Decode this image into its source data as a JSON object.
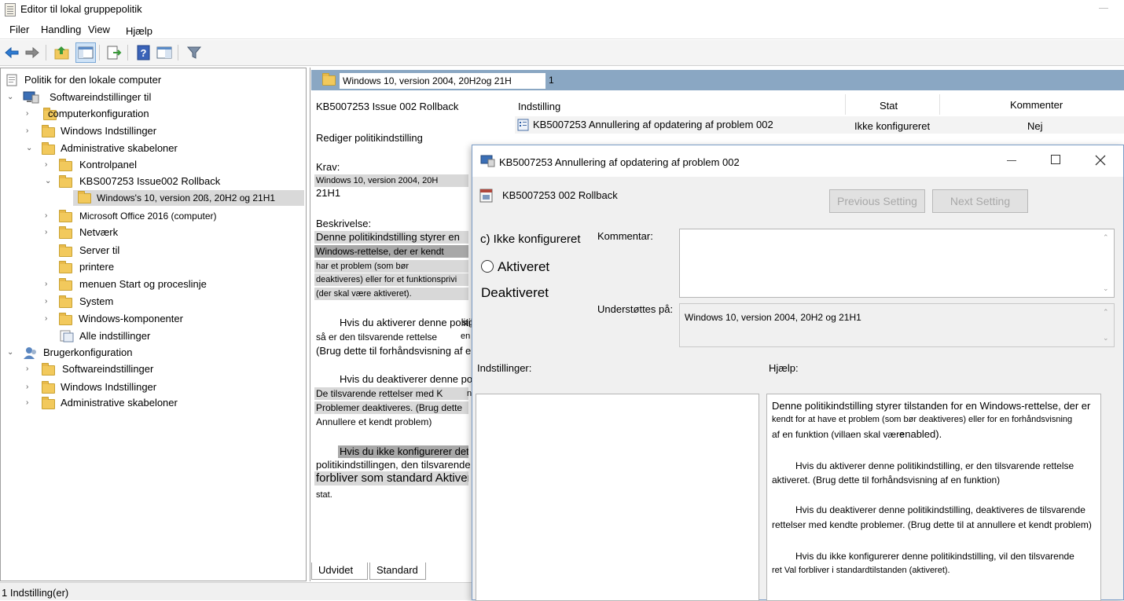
{
  "window": {
    "title": "Editor til lokal gruppepolitik"
  },
  "menu": {
    "items": [
      "Filer",
      "Handling",
      "View",
      "Hjælp"
    ]
  },
  "toolbar": {
    "icons": [
      "back-icon",
      "forward-icon",
      "up-folder-icon",
      "show-hide-tree-icon",
      "export-list-icon",
      "help-icon",
      "properties-pane-icon",
      "filter-icon"
    ]
  },
  "tree": {
    "root": "Politik for den lokale computer",
    "computer": "Softwareindstillinger til",
    "computer_cont": "computerkonfiguration",
    "windows_settings": "Windows Indstillinger",
    "admin_templates": "Administrative skabeloner",
    "control_panel": "Kontrolpanel",
    "kb_rollback": "KBS007253 Issue002 Rollback",
    "windows_version": "Windows's 10, version 20ß, 20H2 og 21H1",
    "office": "Microsoft Office 2016 (computer)",
    "network": "Netværk",
    "server": "Server til",
    "printers": "printere",
    "start_menu": "menuen Start og proceslinje",
    "system": "System",
    "windows_components": "Windows-komponenter",
    "all_settings": "Alle indstillinger",
    "user_config": "Brugerkonfiguration",
    "user_software": "Softwareindstillinger",
    "user_windows": "Windows Indstillinger",
    "user_admin": "Administrative skabeloner"
  },
  "right_pane": {
    "header": "Windows 10, version 2004, 20H2og 21H",
    "header_suffix": "1",
    "policy_title": "KB5007253 Issue 002 Rollback",
    "edit_link": "Rediger politikindstilling",
    "requirements_label": "Krav:",
    "requirements_line1": "Windows 10, version 2004, 20H",
    "requirements_line2": "21H1",
    "description_label": "Beskrivelse:",
    "desc_lines": [
      "Denne politikindstilling styrer en",
      "Windows-rettelse, der er kendt",
      "har et problem (som bør",
      "deaktiveres) eller for et funktionsprivi",
      "(der skal være aktiveret).",
      "Hvis du aktiverer denne politik,",
      "så er den tilsvarende rettelse",
      "(Brug dette til forhåndsvisning af en funktion)",
      "Hvis du deaktiverer denne politik",
      "De tilsvarende rettelser med K",
      "Problemer deaktiveres. (Brug dette",
      "Annullere et kendt problem)",
      "Hvis du ikke konfigurerer dette",
      "politikindstillingen, den tilsvarende",
      "forbliver som standard Aktiver",
      "stat."
    ],
    "overlap_fragments": [
      "sig",
      "en",
      "n"
    ],
    "columns": {
      "setting": "Indstilling",
      "state": "Stat",
      "comment": "Kommenter"
    },
    "rows": [
      {
        "setting": "KB5007253 Annullering af opdatering af problem 002",
        "state": "Ikke konfigureret",
        "comment": "Nej"
      }
    ],
    "tabs": [
      "Udvidet",
      "Standard"
    ]
  },
  "status_bar": {
    "text": "1 Indstilling(er)"
  },
  "dialog": {
    "title": "KB5007253  Annullering af opdatering af problem 002",
    "subtitle": "KB5007253 002 Rollback",
    "prev_button": "Previous Setting",
    "next_button": "Next Setting",
    "option_not_configured": "c) Ikke konfigureret",
    "option_enabled": "Aktiveret",
    "option_disabled": "Deaktiveret",
    "comment_label": "Kommentar:",
    "supported_label": "Understøttes på:",
    "supported_value": "Windows 10, version 2004, 20H2 og 21H1",
    "options_label": "Indstillinger:",
    "help_label": "Hjælp:",
    "help_lines": [
      "Denne politikindstilling styrer tilstanden for en Windows-rettelse, der er",
      "kendt for at have et problem (som bør deaktiveres) eller for en forhåndsvisning",
      "af en funktion (villaen skal være",
      "enabled).",
      "Hvis du aktiverer denne politikindstilling, er den tilsvarende rettelse",
      "aktiveret. (Brug dette til forhåndsvisning af en funktion)",
      "Hvis du deaktiverer denne politikindstilling, deaktiveres de tilsvarende",
      "rettelser med kendte problemer. (Brug dette til at annullere et kendt problem)",
      "Hvis du ikke konfigurerer denne politikindstilling, vil den tilsvarende",
      "ret Val forbliver i standardtilstanden (aktiveret)."
    ]
  },
  "colors": {
    "header_blue": "#8aa7c3",
    "selection_gray": "#d9d9d9",
    "dialog_border": "#7a9cc7"
  }
}
